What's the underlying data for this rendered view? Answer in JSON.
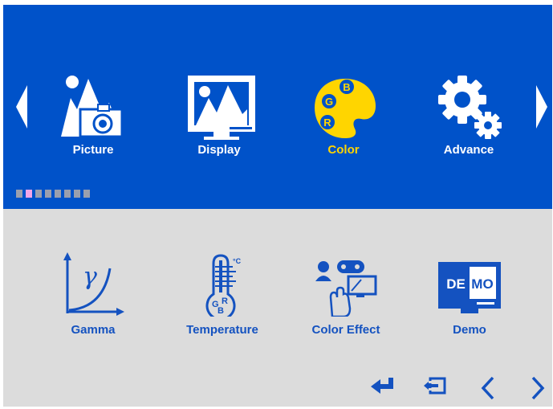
{
  "main_menu": {
    "items": [
      {
        "label": "Picture",
        "icon": "picture-icon",
        "active": false
      },
      {
        "label": "Display",
        "icon": "display-icon",
        "active": false
      },
      {
        "label": "Color",
        "icon": "color-palette-icon",
        "active": true
      },
      {
        "label": "Advance",
        "icon": "gears-icon",
        "active": false
      }
    ],
    "page_indicator": {
      "count": 8,
      "active_index": 1
    }
  },
  "submenu": {
    "items": [
      {
        "label": "Gamma",
        "icon": "gamma-icon"
      },
      {
        "label": "Temperature",
        "icon": "thermometer-icon"
      },
      {
        "label": "Color Effect",
        "icon": "color-effect-icon"
      },
      {
        "label": "Demo",
        "icon": "demo-icon"
      }
    ]
  },
  "demo_icon_text": {
    "left": "DE",
    "right": "MO"
  },
  "palette_letters": {
    "g": "G",
    "b": "B",
    "r": "R"
  },
  "thermometer_text": {
    "unit": "°C",
    "g": "G",
    "r": "R",
    "b": "B"
  },
  "gamma_symbol": "γ",
  "bottom_nav": [
    "enter-icon",
    "exit-icon",
    "left-icon",
    "right-icon"
  ],
  "colors": {
    "top_bg": "#0052c9",
    "bottom_bg": "#dcdcdc",
    "active_label": "#ffd500",
    "sub_label": "#1452c0"
  }
}
